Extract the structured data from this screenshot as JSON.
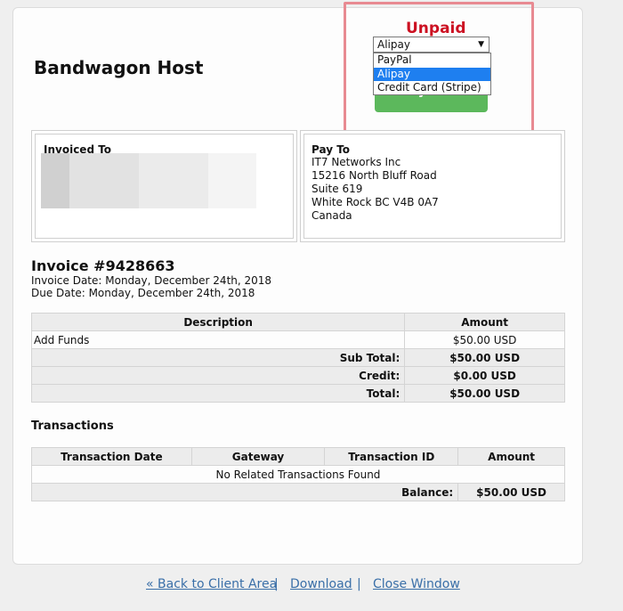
{
  "company_name": "Bandwagon Host",
  "status": "Unpaid",
  "payment": {
    "selected_method": "Alipay",
    "options": [
      "PayPal",
      "Alipay",
      "Credit Card (Stripe)"
    ],
    "pay_button_label": "Pay Now"
  },
  "invoiced_to": {
    "title": "Invoiced To"
  },
  "pay_to": {
    "title": "Pay To",
    "lines": [
      "IT7 Networks Inc",
      "15216 North Bluff Road",
      "Suite 619",
      "White Rock BC V4B 0A7",
      "Canada"
    ]
  },
  "invoice": {
    "title": "Invoice #9428663",
    "invoice_date": "Invoice Date: Monday, December 24th, 2018",
    "due_date": "Due Date: Monday, December 24th, 2018"
  },
  "items_table": {
    "headers": [
      "Description",
      "Amount"
    ],
    "rows": [
      [
        "Add Funds",
        "$50.00 USD"
      ]
    ],
    "subtotal_label": "Sub Total:",
    "subtotal": "$50.00 USD",
    "credit_label": "Credit:",
    "credit": "$0.00 USD",
    "total_label": "Total:",
    "total": "$50.00 USD"
  },
  "transactions": {
    "heading": "Transactions",
    "headers": [
      "Transaction Date",
      "Gateway",
      "Transaction ID",
      "Amount"
    ],
    "empty_message": "No Related Transactions Found",
    "balance_label": "Balance:",
    "balance": "$50.00 USD"
  },
  "footer": {
    "back_link": "« Back to Client Area",
    "download_link": "Download",
    "close_link": "Close Window",
    "separator": "|"
  },
  "colors": {
    "unpaid": "#cc1122",
    "pay_button": "#5cb85c",
    "highlight": "#e88a92",
    "link": "#3a6fa8"
  }
}
